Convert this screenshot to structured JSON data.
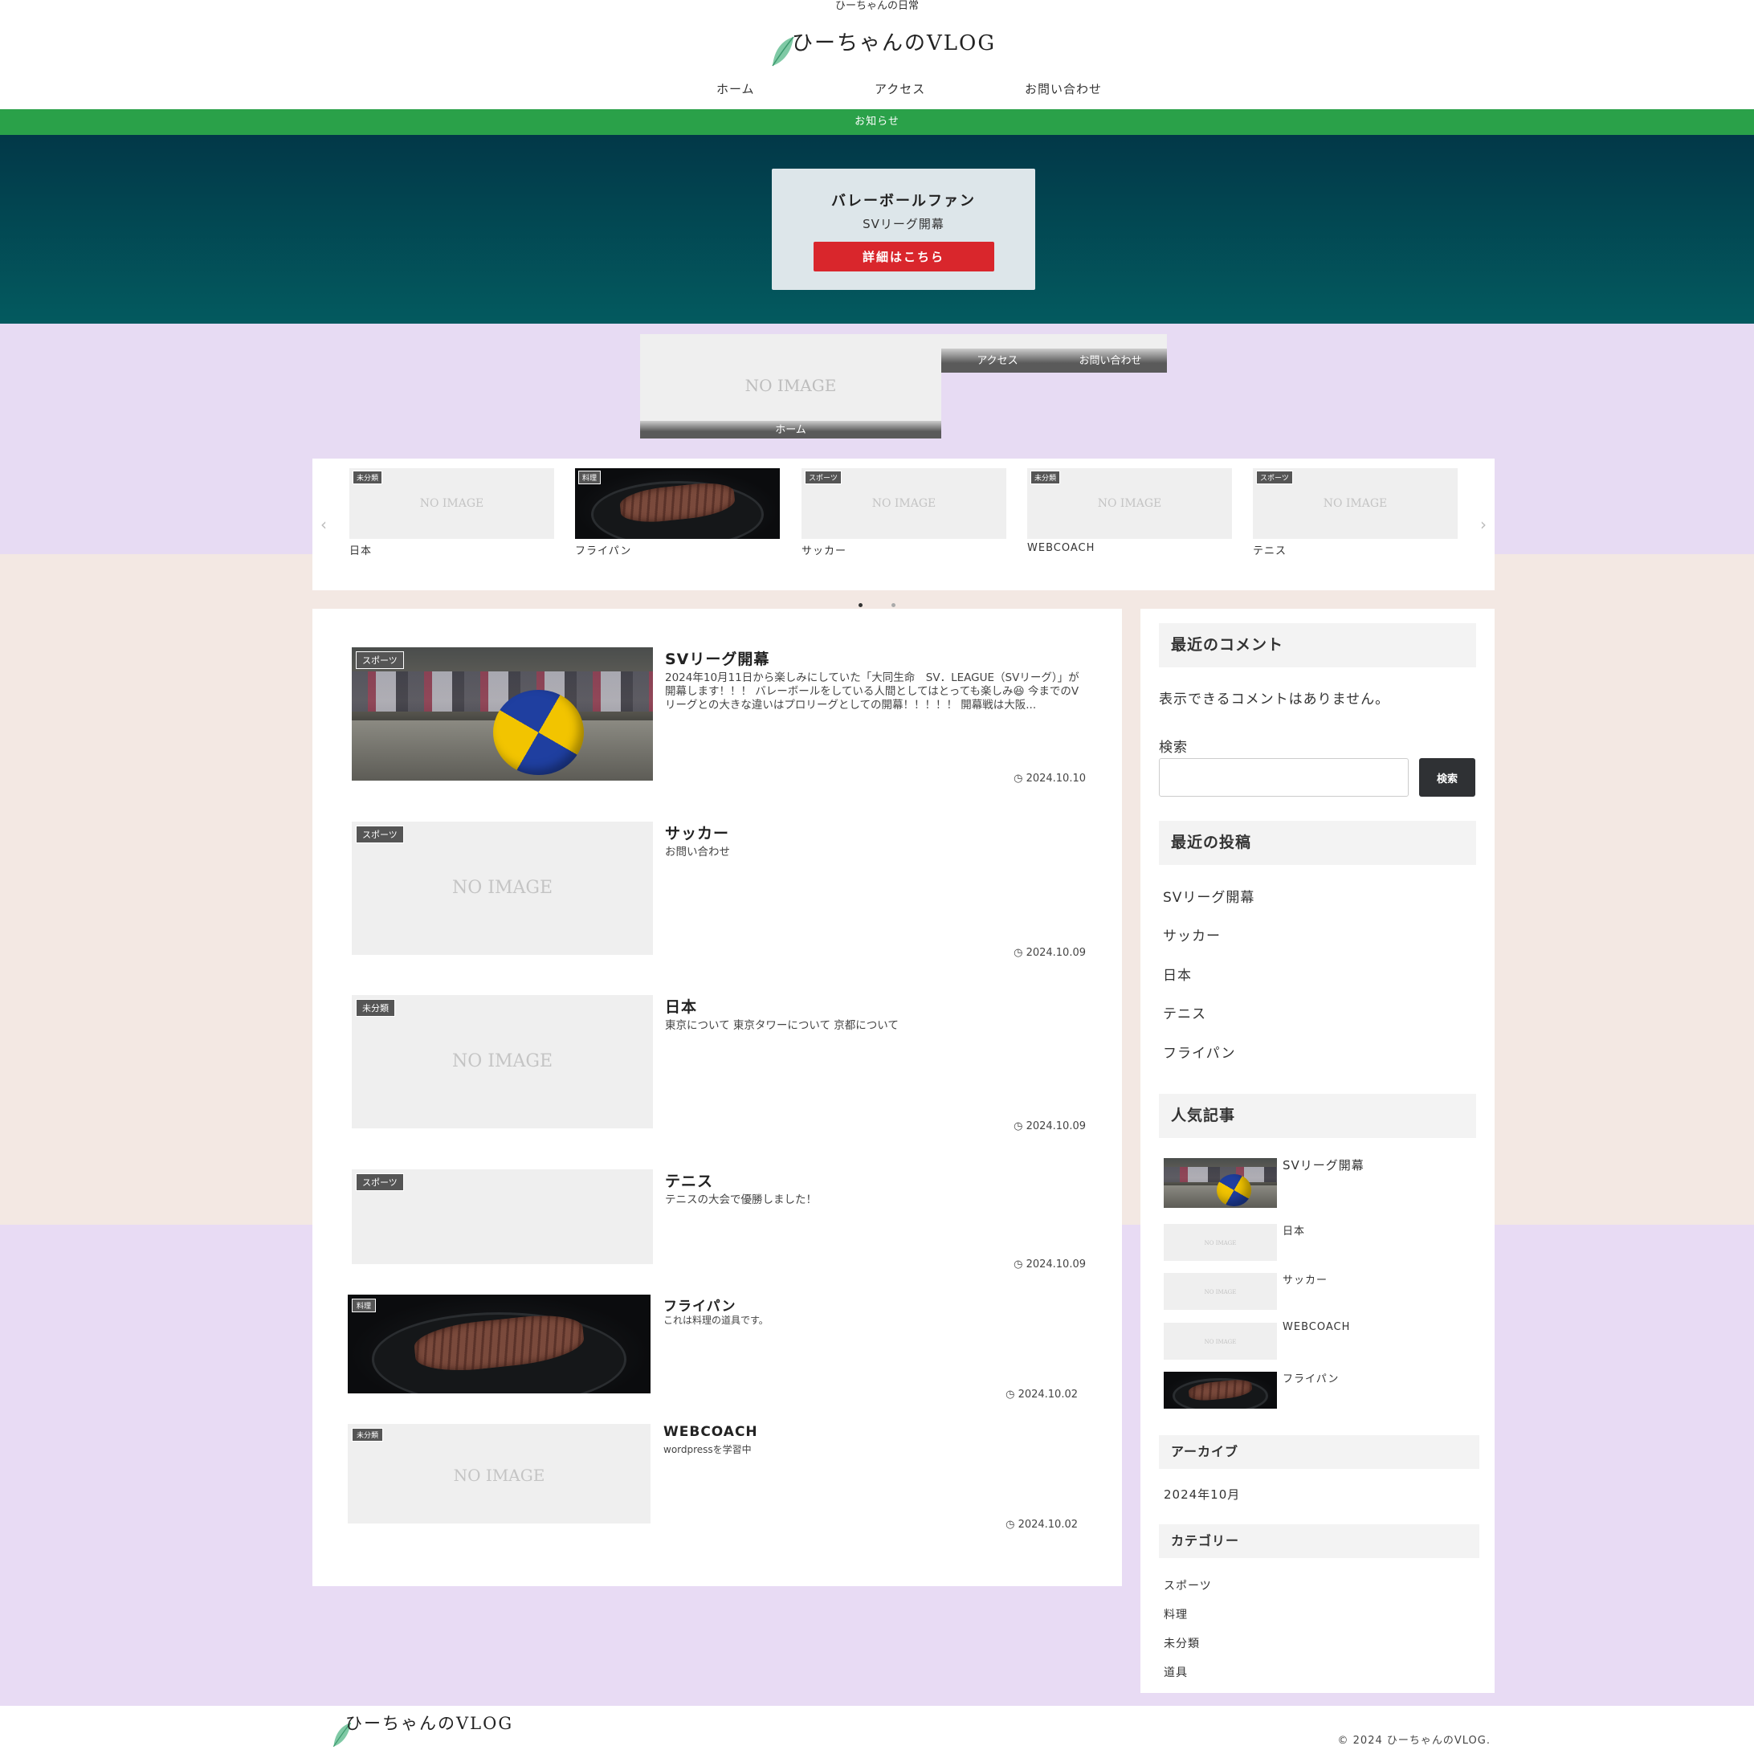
{
  "header": {
    "tagline": "ひーちゃんの日常",
    "logo_text": "ひーちゃんのVLOG",
    "nav": [
      "ホーム",
      "アクセス",
      "お問い合わせ"
    ],
    "notice": "お知らせ"
  },
  "hero": {
    "title": "バレーボールファン",
    "subtitle": "SVリーグ開幕",
    "button": "詳細はこちら"
  },
  "nav_cards": [
    {
      "label": "ホーム",
      "placeholder": "NO IMAGE"
    },
    {
      "label": "アクセス"
    },
    {
      "label": "お問い合わせ"
    }
  ],
  "carousel": {
    "prev": "‹",
    "next": "›",
    "items": [
      {
        "category": "未分類",
        "title": "日本",
        "image": "NO IMAGE"
      },
      {
        "category": "料理",
        "title": "フライパン",
        "image": "steak-photo"
      },
      {
        "category": "スポーツ",
        "title": "サッカー",
        "image": "NO IMAGE"
      },
      {
        "category": "未分類",
        "title": "WEBCOACH",
        "image": "NO IMAGE"
      },
      {
        "category": "スポーツ",
        "title": "テニス",
        "image": "NO IMAGE"
      }
    ]
  },
  "posts": [
    {
      "category": "スポーツ",
      "title": "SVリーグ開幕",
      "excerpt": "2024年10月11日から楽しみにしていた「大同生命　SV．LEAGUE（SVリーグ）」が開幕します！！！ バレーボールをしている人間としてはとっても楽しみ😆 今までのVリーグとの大きな違いはプロリーグとしての開幕！！！！！ 開幕戦は大阪...",
      "date": "2024.10.10",
      "image": "volleyball-photo"
    },
    {
      "category": "スポーツ",
      "title": "サッカー",
      "excerpt": "お問い合わせ",
      "date": "2024.10.09",
      "image": "NO IMAGE"
    },
    {
      "category": "未分類",
      "title": "日本",
      "excerpt": "東京について 東京タワーについて 京都について",
      "date": "2024.10.09",
      "image": "NO IMAGE"
    },
    {
      "category": "スポーツ",
      "title": "テニス",
      "excerpt": "テニスの大会で優勝しました！",
      "date": "2024.10.09",
      "image": "NO IMAGE"
    },
    {
      "category": "料理",
      "title": "フライパン",
      "excerpt": "これは料理の道具です。",
      "date": "2024.10.02",
      "image": "steak-photo"
    },
    {
      "category": "未分類",
      "title": "WEBCOACH",
      "excerpt": "wordpressを学習中",
      "date": "2024.10.02",
      "image": "NO IMAGE"
    }
  ],
  "sidebar": {
    "recent_comments": {
      "heading": "最近のコメント",
      "empty": "表示できるコメントはありません。"
    },
    "search": {
      "label": "検索",
      "placeholder": "",
      "button": "検索"
    },
    "recent_posts": {
      "heading": "最近の投稿",
      "items": [
        "SVリーグ開幕",
        "サッカー",
        "日本",
        "テニス",
        "フライパン"
      ]
    },
    "popular": {
      "heading": "人気記事",
      "items": [
        {
          "title": "SVリーグ開幕",
          "image": "volleyball-photo"
        },
        {
          "title": "日本",
          "image": "NO IMAGE"
        },
        {
          "title": "サッカー",
          "image": "NO IMAGE"
        },
        {
          "title": "WEBCOACH",
          "image": "NO IMAGE"
        },
        {
          "title": "フライパン",
          "image": "steak-photo"
        }
      ]
    },
    "archive": {
      "heading": "アーカイブ",
      "items": [
        "2024年10月"
      ]
    },
    "categories": {
      "heading": "カテゴリー",
      "items": [
        "スポーツ",
        "料理",
        "未分類",
        "道具"
      ]
    }
  },
  "footer": {
    "logo_text": "ひーちゃんのVLOG",
    "copyright": "© 2024 ひーちゃんのVLOG."
  },
  "icons": {
    "date": "clock-icon",
    "logo": "leaf-icon",
    "carousel_prev": "chevron-left-icon",
    "carousel_next": "chevron-right-icon"
  },
  "colors": {
    "notice_bar": "#2aa149",
    "hero_button": "#d9262c",
    "search_button": "#2f3134",
    "lavender_bg": "#e7dbf3",
    "beige_bg": "#f3e8e3"
  }
}
